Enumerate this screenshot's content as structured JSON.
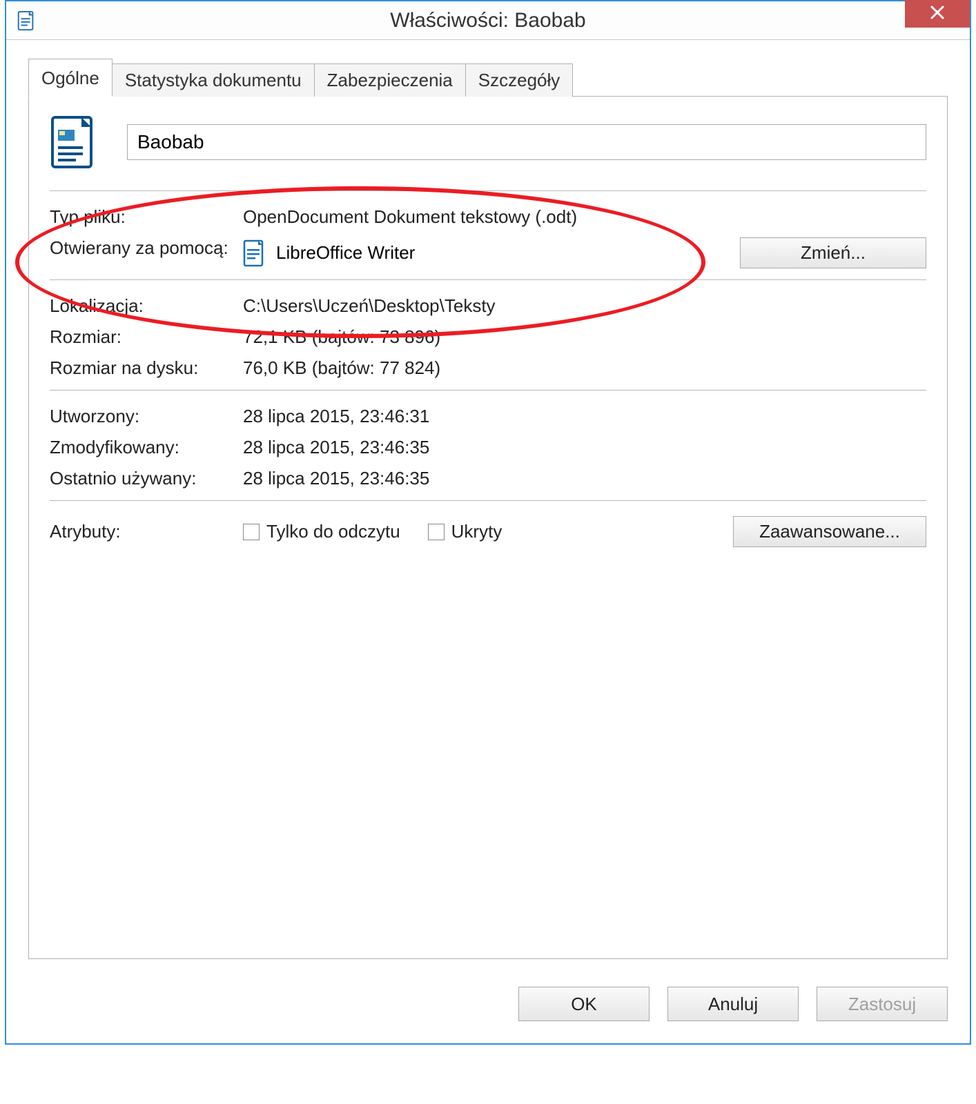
{
  "window": {
    "title": "Właściwości: Baobab"
  },
  "tabs": {
    "general": "Ogólne",
    "stats": "Statystyka dokumentu",
    "security": "Zabezpieczenia",
    "details": "Szczegóły"
  },
  "general": {
    "filename": "Baobab",
    "filetype_label": "Typ pliku:",
    "filetype_value": "OpenDocument Dokument tekstowy (.odt)",
    "openwith_label": "Otwierany za pomocą:",
    "openwith_value": "LibreOffice Writer",
    "change_btn": "Zmień...",
    "location_label": "Lokalizacja:",
    "location_value": "C:\\Users\\Uczeń\\Desktop\\Teksty",
    "size_label": "Rozmiar:",
    "size_value": "72,1 KB (bajtów: 73 896)",
    "disksize_label": "Rozmiar na dysku:",
    "disksize_value": "76,0 KB (bajtów: 77 824)",
    "created_label": "Utworzony:",
    "created_value": "28 lipca 2015, 23:46:31",
    "modified_label": "Zmodyfikowany:",
    "modified_value": "28 lipca 2015, 23:46:35",
    "accessed_label": "Ostatnio używany:",
    "accessed_value": "28 lipca 2015, 23:46:35",
    "attributes_label": "Atrybuty:",
    "readonly_label": "Tylko do odczytu",
    "hidden_label": "Ukryty",
    "advanced_btn": "Zaawansowane..."
  },
  "footer": {
    "ok": "OK",
    "cancel": "Anuluj",
    "apply": "Zastosuj"
  }
}
